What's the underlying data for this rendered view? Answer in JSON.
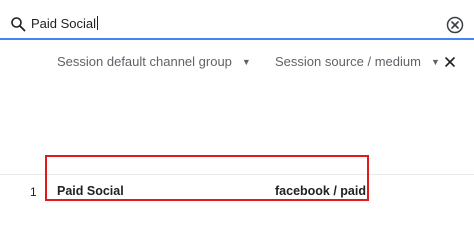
{
  "search": {
    "icon": "search-icon",
    "value": "Paid Social",
    "clear_icon": "clear-circle-icon",
    "accent_color": "#4285f4"
  },
  "table": {
    "columns": [
      {
        "label": "Session default channel group",
        "icon": "dropdown-caret-icon"
      },
      {
        "label": "Session source / medium",
        "icon": "dropdown-caret-icon"
      }
    ],
    "remove_icon": "close-icon",
    "rows": [
      {
        "index": "1",
        "channel_group": "Paid Social",
        "source_medium": "facebook / paid"
      }
    ]
  },
  "highlight": {
    "color": "#e2191c"
  }
}
